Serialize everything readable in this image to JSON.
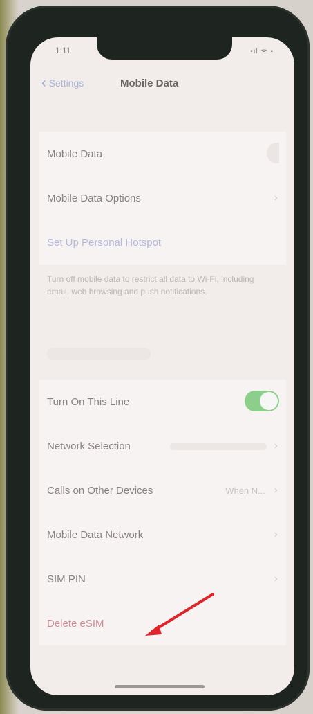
{
  "status": {
    "time": "1:11",
    "icons": "•ıl ᯤ ▪"
  },
  "nav": {
    "back_label": "Settings",
    "title": "Mobile Data"
  },
  "section1": {
    "mobile_data_label": "Mobile Data",
    "mobile_data_options_label": "Mobile Data Options",
    "hotspot_label": "Set Up Personal Hotspot",
    "description": "Turn off mobile data to restrict all data to Wi-Fi, including email, web browsing and push notifications."
  },
  "section2": {
    "turn_on_line_label": "Turn On This Line",
    "network_selection_label": "Network Selection",
    "calls_other_devices_label": "Calls on Other Devices",
    "calls_other_devices_value": "When N...",
    "mobile_data_network_label": "Mobile Data Network",
    "sim_pin_label": "SIM PIN",
    "delete_esim_label": "Delete eSIM"
  },
  "colors": {
    "toggle_on": "#8ccf8a",
    "link": "#b3b9dc",
    "destructive": "#d18d96",
    "annotation_arrow": "#e0242b"
  },
  "toggles": {
    "mobile_data": false,
    "turn_on_this_line": true
  }
}
